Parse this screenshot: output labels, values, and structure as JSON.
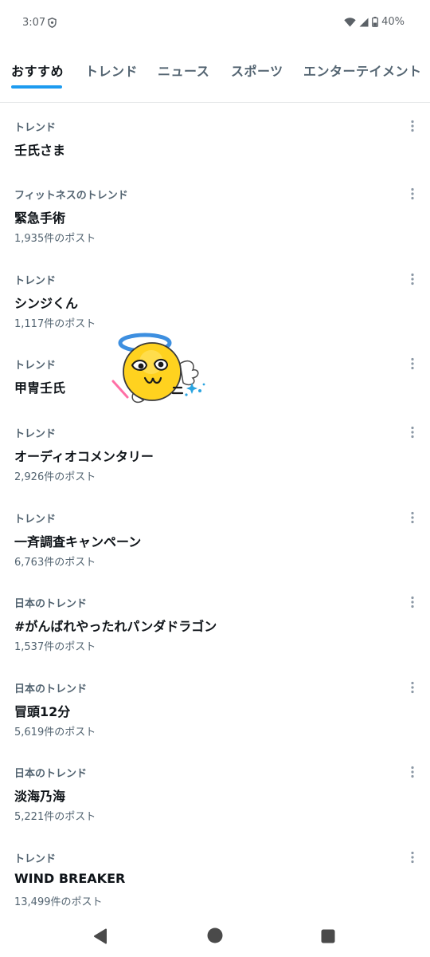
{
  "status_bar": {
    "time": "3:07",
    "battery": "40%"
  },
  "tabs": [
    {
      "label": "おすすめ",
      "active": true
    },
    {
      "label": "トレンド",
      "active": false
    },
    {
      "label": "ニュース",
      "active": false
    },
    {
      "label": "スポーツ",
      "active": false
    },
    {
      "label": "エンターテイメント",
      "active": false
    }
  ],
  "trends": [
    {
      "category": "トレンド",
      "title": "壬氏さま",
      "count": ""
    },
    {
      "category": "フィットネスのトレンド",
      "title": "緊急手術",
      "count": "1,935件のポスト"
    },
    {
      "category": "トレンド",
      "title": "シンジくん",
      "count": "1,117件のポスト"
    },
    {
      "category": "トレンド",
      "title": "甲冑壬氏",
      "count": ""
    },
    {
      "category": "トレンド",
      "title": "オーディオコメンタリー",
      "count": "2,926件のポスト"
    },
    {
      "category": "トレンド",
      "title": "一斉調査キャンペーン",
      "count": "6,763件のポスト"
    },
    {
      "category": "日本のトレンド",
      "title": "#がんばれやったれパンダドラゴン",
      "count": "1,537件のポスト"
    },
    {
      "category": "日本のトレンド",
      "title": "冒頭12分",
      "count": "5,619件のポスト"
    },
    {
      "category": "日本のトレンド",
      "title": "淡海乃海",
      "count": "5,221件のポスト"
    },
    {
      "category": "トレンド",
      "title": "WIND BREAKER",
      "count": "13,499件のポスト"
    }
  ],
  "colors": {
    "accent": "#1d9bf0",
    "secondary_text": "#536471",
    "primary_text": "#0f1419"
  }
}
